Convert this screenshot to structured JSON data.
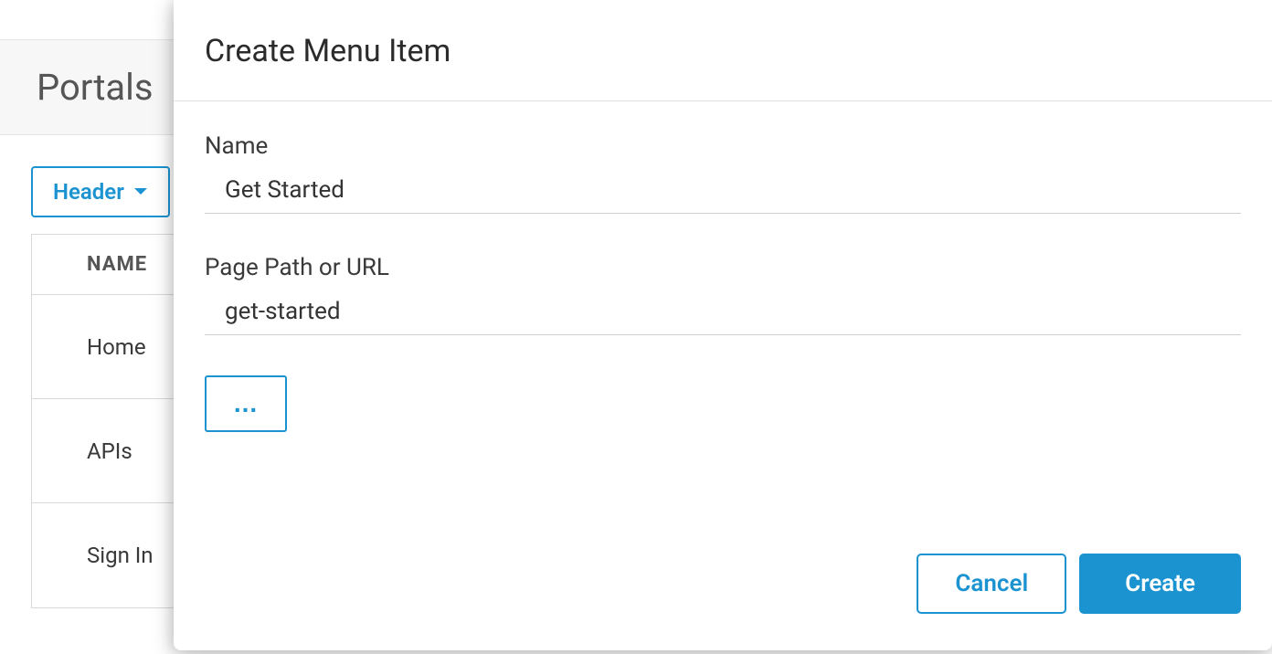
{
  "background": {
    "page_title": "Portals",
    "header_dropdown_label": "Header",
    "table": {
      "column_header": "NAME",
      "rows": [
        "Home",
        "APIs",
        "Sign In"
      ]
    }
  },
  "modal": {
    "title": "Create Menu Item",
    "fields": {
      "name": {
        "label": "Name",
        "value": "Get Started"
      },
      "path": {
        "label": "Page Path or URL",
        "value": "get-started"
      }
    },
    "more_button_label": "...",
    "cancel_label": "Cancel",
    "create_label": "Create"
  }
}
